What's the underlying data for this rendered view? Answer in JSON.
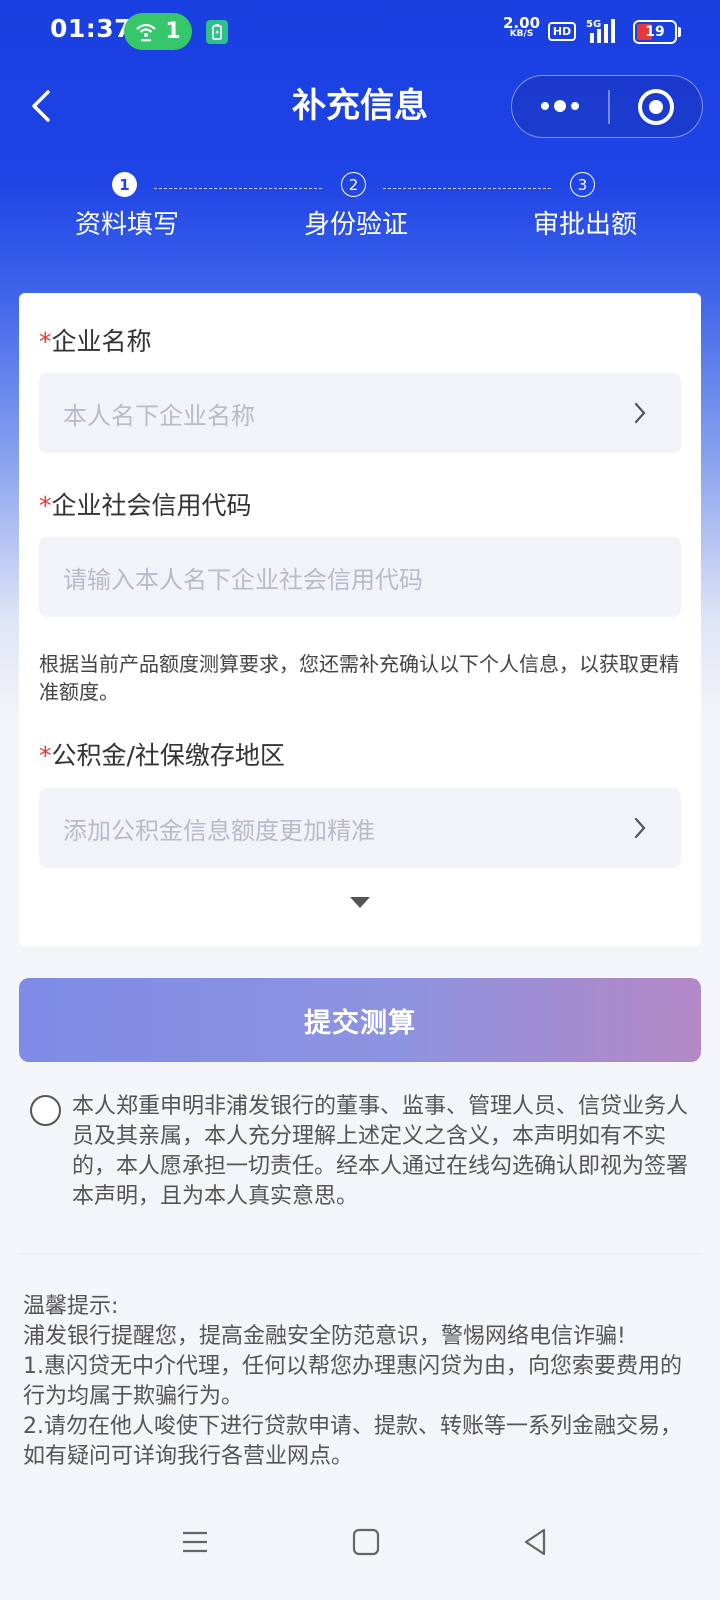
{
  "status_bar": {
    "time": "01:37",
    "hotspot_count": "1",
    "net_speed_value": "2.00",
    "net_speed_unit": "KB/S",
    "hd_label": "HD",
    "network_type": "5G",
    "battery_level": "19",
    "battery_fraction": 0.19,
    "battery_color": "#e5383b"
  },
  "nav": {
    "title": "补充信息",
    "icons": [
      "back-arrow-icon",
      "more-dots-icon",
      "target-close-icon"
    ]
  },
  "steps": [
    {
      "number": "1",
      "label": "资料填写",
      "active": true
    },
    {
      "number": "2",
      "label": "身份验证",
      "active": false
    },
    {
      "number": "3",
      "label": "审批出额",
      "active": false
    }
  ],
  "form": {
    "required_mark": "*",
    "company_name": {
      "label": "企业名称",
      "placeholder": "本人名下企业名称"
    },
    "credit_code": {
      "label": "企业社会信用代码",
      "placeholder": "请输入本人名下企业社会信用代码"
    },
    "hint": "根据当前产品额度测算要求，您还需补充确认以下个人信息，以获取更精准额度。",
    "fund_region": {
      "label": "公积金/社保缴存地区",
      "placeholder": "添加公积金信息额度更加精准"
    }
  },
  "submit_label": "提交测算",
  "declaration": "本人郑重申明非浦发银行的董事、监事、管理人员、信贷业务人员及其亲属，本人充分理解上述定义之含义，本声明如有不实的，本人愿承担一切责任。经本人通过在线勾选确认即视为签署本声明，且为本人真实意思。",
  "tips": {
    "title": "温馨提示:",
    "line1": "浦发银行提醒您，提高金融安全防范意识，警惕网络电信诈骗!",
    "line2": "1.惠闪贷无中介代理，任何以帮您办理惠闪贷为由，向您索要费用的行为均属于欺骗行为。",
    "line3": "2.请勿在他人唆使下进行贷款申请、提款、转账等一系列金融交易，如有疑问可详询我行各营业网点。"
  },
  "colors": {
    "header_blue": "#1f44e6",
    "required_red": "#e53935",
    "submit_gradient_start": "#7d8ce6",
    "submit_gradient_end": "#b488c6"
  }
}
